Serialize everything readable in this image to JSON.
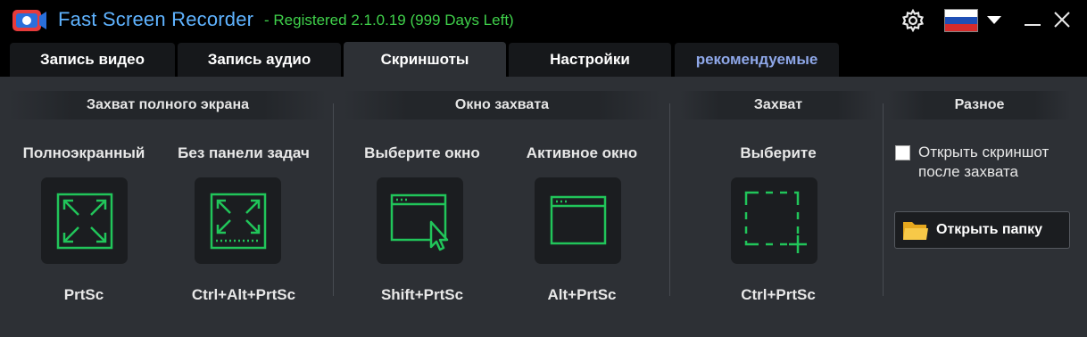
{
  "app": {
    "title": "Fast Screen Recorder",
    "registration": "- Registered 2.1.0.19 (999 Days Left)"
  },
  "tabs": [
    {
      "label": "Запись видео"
    },
    {
      "label": "Запись аудио"
    },
    {
      "label": "Скриншоты",
      "active": true
    },
    {
      "label": "Настройки"
    },
    {
      "label": "рекомендуемые"
    }
  ],
  "sections": {
    "fullscreen": "Захват полного экрана",
    "window": "Окно захвата",
    "capture": "Захват",
    "misc": "Разное"
  },
  "capture_items": [
    {
      "label": "Полноэкранный",
      "hotkey": "PrtSc",
      "icon": "fullscreen-icon"
    },
    {
      "label": "Без панели задач",
      "hotkey": "Ctrl+Alt+PrtSc",
      "icon": "fullscreen-no-taskbar-icon"
    },
    {
      "label": "Выберите окно",
      "hotkey": "Shift+PrtSc",
      "icon": "select-window-icon"
    },
    {
      "label": "Активное окно",
      "hotkey": "Alt+PrtSc",
      "icon": "active-window-icon"
    },
    {
      "label": "Выберите",
      "hotkey": "Ctrl+PrtSc",
      "icon": "select-region-icon"
    }
  ],
  "misc": {
    "open_after_label": "Открыть скриншот после захвата",
    "open_after_checked": false,
    "open_folder_label": "Открыть папку"
  },
  "colors": {
    "accent_green": "#3fd04a",
    "title_blue": "#5fb3ff",
    "icon_green": "#21c55a"
  }
}
